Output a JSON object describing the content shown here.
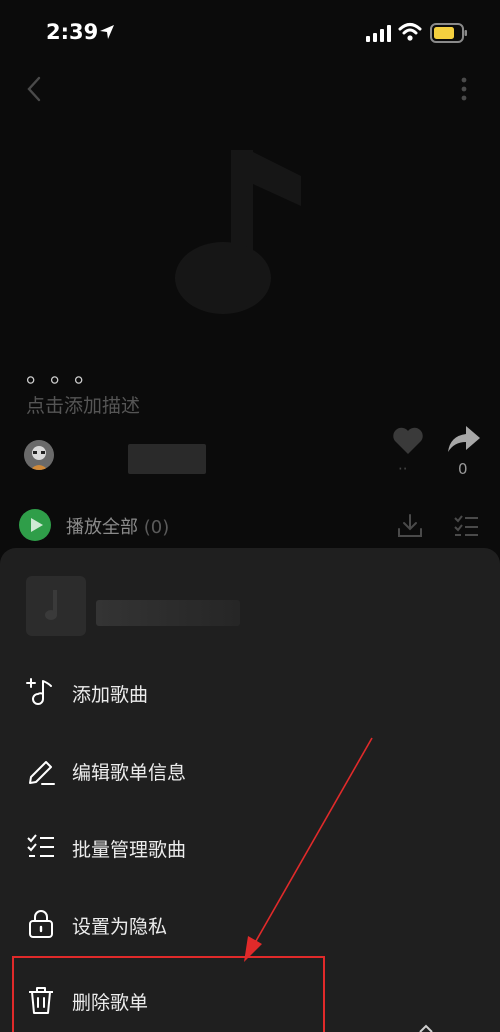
{
  "status_bar": {
    "time": "2:39"
  },
  "playlist": {
    "name": "。。。",
    "description": "点击添加描述",
    "share_count": "0",
    "play_all_label": "播放全部",
    "track_count": "(0)"
  },
  "menu": {
    "items": [
      {
        "label": "添加歌曲",
        "icon": "add-song-icon"
      },
      {
        "label": "编辑歌单信息",
        "icon": "edit-pencil-icon"
      },
      {
        "label": "批量管理歌曲",
        "icon": "batch-list-icon"
      },
      {
        "label": "设置为隐私",
        "icon": "lock-icon"
      },
      {
        "label": "删除歌单",
        "icon": "trash-icon"
      }
    ]
  },
  "colors": {
    "accent_green": "#2f9e49",
    "annotation_red": "#e02a2a"
  }
}
